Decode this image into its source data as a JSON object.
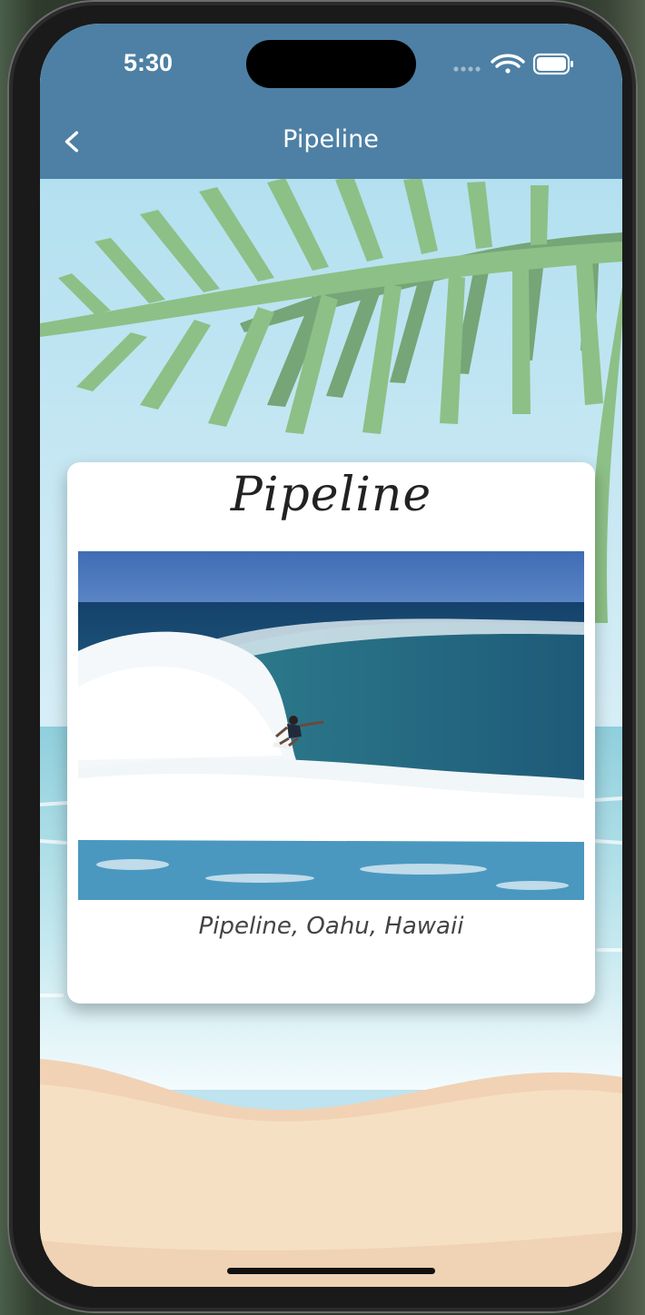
{
  "status_bar": {
    "time": "5:30",
    "icons": [
      "signal-dots-icon",
      "wifi-icon",
      "battery-icon"
    ]
  },
  "navbar": {
    "back_icon": "chevron-left-icon",
    "title": "Pipeline",
    "background": "#4d80a4"
  },
  "card": {
    "title": "Pipeline",
    "photo_subject": "surfer-barrel-wave",
    "caption": "Pipeline, Oahu, Hawaii"
  },
  "colors": {
    "sky": "#bfe3ef",
    "palm": "#8cbf86",
    "ocean": "#9fd6e0",
    "sand": "#f4dcbd"
  }
}
